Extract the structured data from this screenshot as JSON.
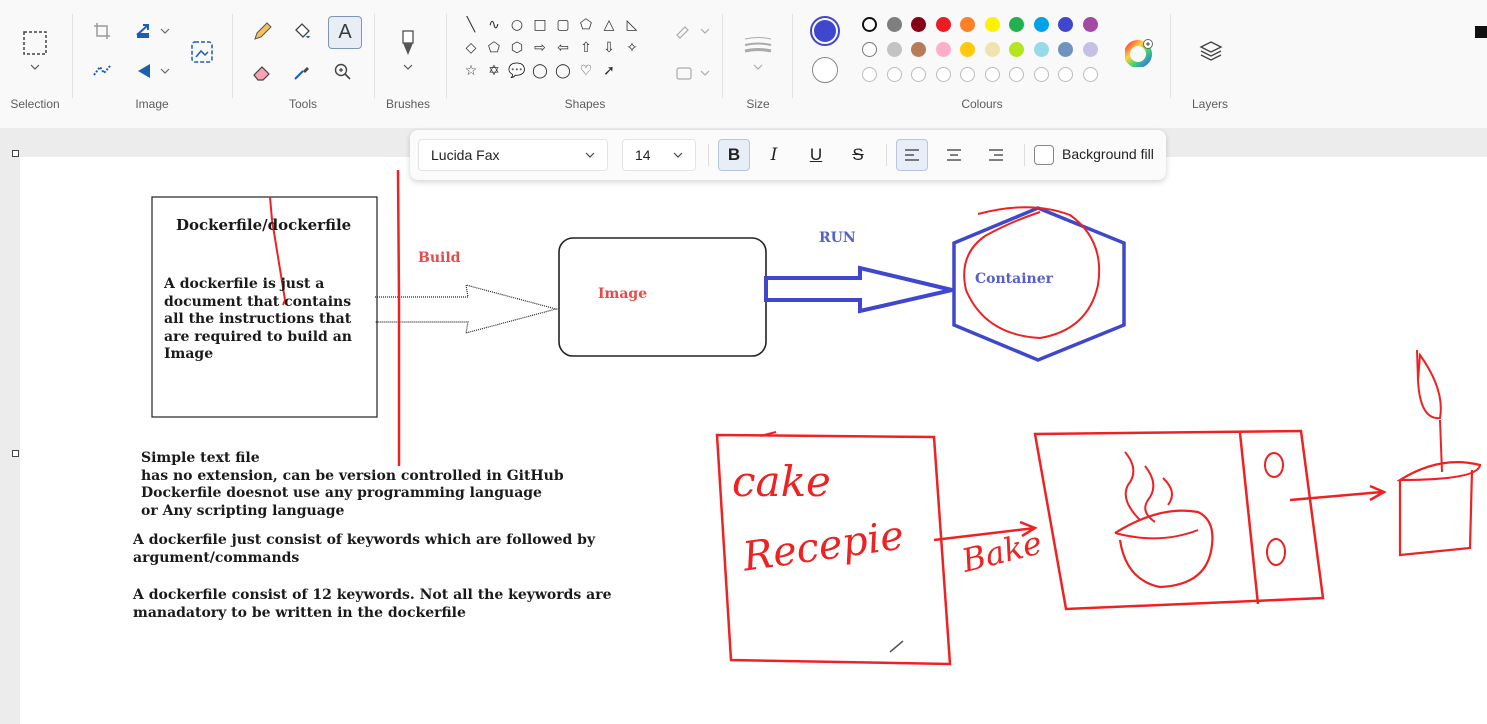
{
  "ribbon": {
    "groups": {
      "selection": "Selection",
      "image": "Image",
      "tools": "Tools",
      "brushes": "Brushes",
      "shapes": "Shapes",
      "size": "Size",
      "colours": "Colours",
      "layers": "Layers"
    },
    "shape_glyphs": [
      "╲",
      "∿",
      "○",
      "□",
      "▢",
      "⬠",
      "△",
      "◺",
      "◇",
      "⬠",
      "⬡",
      "⇨",
      "⇦",
      "⇧",
      "⇩",
      "✧",
      "☆",
      "✡",
      "💬",
      "◯",
      "◯",
      "♡",
      "➚"
    ],
    "colours_row1": [
      "#000000",
      "#7f7f7f",
      "#880015",
      "#ed1c24",
      "#ff7f27",
      "#fff200",
      "#22b14c",
      "#00a2e8",
      "#3f48cc",
      "#a349a4"
    ],
    "colours_row2": [
      "#ffffff",
      "#c3c3c3",
      "#b97a57",
      "#ffaec9",
      "#ffc90e",
      "#efe4b0",
      "#b5e61d",
      "#99d9ea",
      "#7092be",
      "#c8bfe7"
    ],
    "primary_colour": "#3f48cc",
    "secondary_colour": "#ffffff"
  },
  "text_toolbar": {
    "font": "Lucida Fax",
    "size": "14",
    "bold": "B",
    "italic": "I",
    "underline": "U",
    "strike": "S",
    "background_fill": "Background fill"
  },
  "canvas": {
    "box_title": "Dockerfile/dockerfile",
    "box_body": [
      "A dockerfile is just a",
      "document that contains",
      "all the instructions that",
      "are required to build an",
      "Image"
    ],
    "build_label": "Build",
    "image_label": "Image",
    "run_label": "RUN",
    "container_label": "Container",
    "notes_1": [
      "Simple text file",
      "has no extension, can be version controlled in GitHub",
      "Dockerfile doesnot use any programming language",
      "or Any scripting language"
    ],
    "notes_2": [
      "A dockerfile just consist of keywords which are followed by",
      "argument/commands"
    ],
    "notes_3": [
      "A dockerfile consist of 12 keywords. Not all the keywords are",
      "manadatory to be written in the dockerfile"
    ],
    "handwriting": {
      "cake": "cake",
      "recepie": "Recepie",
      "bake": "Bake"
    }
  }
}
